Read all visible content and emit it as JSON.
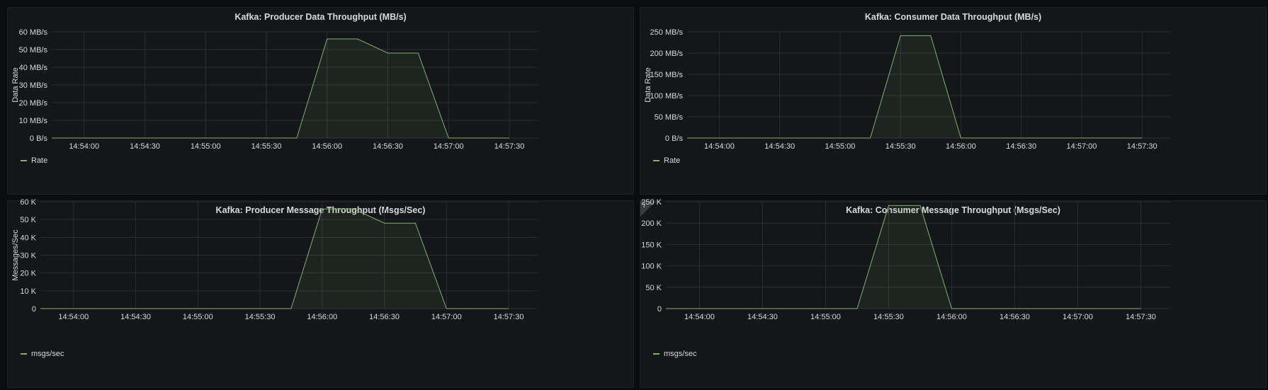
{
  "panels": [
    {
      "title": "Kafka: Producer Data Throughput (MB/s)",
      "legend": "Rate",
      "info_icon": false,
      "chart_data": {
        "type": "area",
        "ylabel": "Data Rate",
        "yticks": [
          "0 B/s",
          "10 MB/s",
          "20 MB/s",
          "30 MB/s",
          "40 MB/s",
          "50 MB/s",
          "60 MB/s"
        ],
        "ylim": [
          0,
          60
        ],
        "xticks": [
          "14:54:00",
          "14:54:30",
          "14:55:00",
          "14:55:30",
          "14:56:00",
          "14:56:30",
          "14:57:00",
          "14:57:30"
        ],
        "xlim": [
          "14:53:44",
          "14:57:44"
        ],
        "series": [
          {
            "name": "Rate",
            "x": [
              "14:53:44",
              "14:55:45",
              "14:56:00",
              "14:56:15",
              "14:56:30",
              "14:56:45",
              "14:57:00",
              "14:57:30"
            ],
            "values": [
              0,
              0,
              56,
              56,
              48,
              48,
              0,
              0
            ]
          }
        ],
        "grid": true,
        "legend_position": "bottom-left",
        "color": "#7eb26d"
      }
    },
    {
      "title": "Kafka: Consumer Data Throughput (MB/s)",
      "legend": "Rate",
      "info_icon": false,
      "chart_data": {
        "type": "area",
        "ylabel": "Data Rate",
        "yticks": [
          "0 B/s",
          "50 MB/s",
          "100 MB/s",
          "150 MB/s",
          "200 MB/s",
          "250 MB/s"
        ],
        "ylim": [
          0,
          250
        ],
        "xticks": [
          "14:54:00",
          "14:54:30",
          "14:55:00",
          "14:55:30",
          "14:56:00",
          "14:56:30",
          "14:57:00",
          "14:57:30"
        ],
        "xlim": [
          "14:53:44",
          "14:57:44"
        ],
        "series": [
          {
            "name": "Rate",
            "x": [
              "14:53:44",
              "14:55:15",
              "14:55:30",
              "14:55:45",
              "14:56:00",
              "14:57:30"
            ],
            "values": [
              0,
              0,
              241,
              241,
              0,
              0
            ]
          }
        ],
        "grid": true,
        "legend_position": "bottom-left",
        "color": "#7eb26d"
      }
    },
    {
      "title": "Kafka: Producer Message Throughput (Msgs/Sec)",
      "legend": "msgs/sec",
      "info_icon": false,
      "chart_data": {
        "type": "area",
        "ylabel": "Messages/Sec",
        "yticks": [
          "0",
          "10 K",
          "20 K",
          "30 K",
          "40 K",
          "50 K",
          "60 K"
        ],
        "ylim": [
          0,
          60000
        ],
        "xticks": [
          "14:54:00",
          "14:54:30",
          "14:55:00",
          "14:55:30",
          "14:56:00",
          "14:56:30",
          "14:57:00",
          "14:57:30"
        ],
        "xlim": [
          "14:53:44",
          "14:57:44"
        ],
        "series": [
          {
            "name": "msgs/sec",
            "x": [
              "14:53:44",
              "14:55:45",
              "14:56:00",
              "14:56:15",
              "14:56:30",
              "14:56:45",
              "14:57:00",
              "14:57:30"
            ],
            "values": [
              0,
              0,
              56000,
              56000,
              48000,
              48000,
              0,
              0
            ]
          }
        ],
        "grid": true,
        "legend_position": "bottom-left",
        "color": "#7eb26d"
      }
    },
    {
      "title": "Kafka: Consumer Message Throughput (Msgs/Sec)",
      "legend": "msgs/sec",
      "info_icon": true,
      "info_glyph": "i",
      "chart_data": {
        "type": "area",
        "ylabel": "",
        "yticks": [
          "0",
          "50 K",
          "100 K",
          "150 K",
          "200 K",
          "250 K"
        ],
        "ylim": [
          0,
          250000
        ],
        "xticks": [
          "14:54:00",
          "14:54:30",
          "14:55:00",
          "14:55:30",
          "14:56:00",
          "14:56:30",
          "14:57:00",
          "14:57:30"
        ],
        "xlim": [
          "14:53:44",
          "14:57:44"
        ],
        "series": [
          {
            "name": "msgs/sec",
            "x": [
              "14:53:44",
              "14:55:15",
              "14:55:30",
              "14:55:45",
              "14:56:00",
              "14:57:30"
            ],
            "values": [
              0,
              0,
              241000,
              241000,
              0,
              0
            ]
          }
        ],
        "grid": true,
        "legend_position": "bottom-left",
        "color": "#7eb26d"
      }
    }
  ],
  "colors": {
    "background": "#0b0c0e",
    "panel": "#141619",
    "grid": "#2c2e33",
    "series": "#7eb26d"
  }
}
